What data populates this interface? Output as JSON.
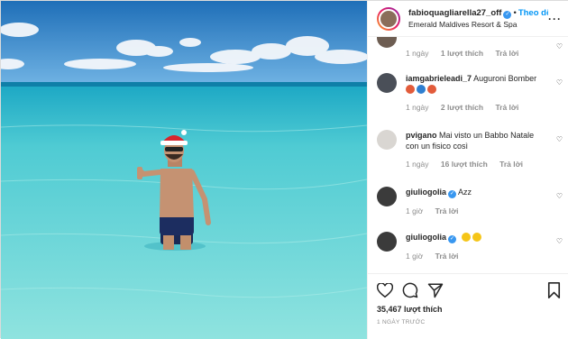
{
  "header": {
    "username": "fabioquagliarella27_off",
    "separator": "•",
    "follow_label": "Theo dõi",
    "location": "Emerald Maldives Resort & Spa",
    "more_label": "···"
  },
  "comments": [
    {
      "username": "",
      "text": "",
      "time": "1 ngày",
      "likes": "1 lượt thích",
      "reply": "Trả lời",
      "verified": false
    },
    {
      "username": "iamgabrieleadi_7",
      "text": "Auguroni Bomber",
      "emojis": [
        "red",
        "blue",
        "red"
      ],
      "time": "1 ngày",
      "likes": "2 lượt thích",
      "reply": "Trả lời",
      "verified": false
    },
    {
      "username": "pvigano",
      "text": "Mai visto un Babbo Natale con un fisico così",
      "time": "1 ngày",
      "likes": "16 lượt thích",
      "reply": "Trả lời",
      "verified": false
    },
    {
      "username": "giuliogolia",
      "text": "Azz",
      "time": "1 giờ",
      "likes": "",
      "reply": "Trả lời",
      "verified": true
    },
    {
      "username": "giuliogolia",
      "text": "",
      "emojis": [
        "yellow",
        "yellow"
      ],
      "time": "1 giờ",
      "likes": "",
      "reply": "Trả lời",
      "verified": true
    }
  ],
  "footer": {
    "likes_count": "35,467",
    "likes_label": "lượt thích",
    "timestamp": "1 NGÀY TRƯỚC"
  },
  "icons": {
    "like": "heart-outline-icon",
    "comment": "comment-bubble-icon",
    "share": "paper-plane-icon",
    "save": "bookmark-icon"
  },
  "colors": {
    "follow": "#0095f6",
    "verified": "#3897f0",
    "sea": "#5fd2d6",
    "sky": "#2f80c8"
  }
}
